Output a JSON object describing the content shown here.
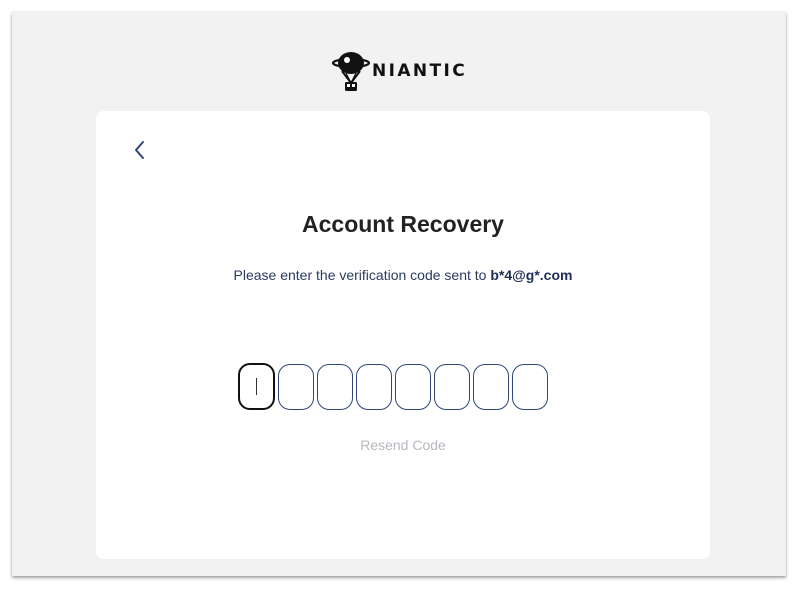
{
  "brand": {
    "name": "NIANTIC",
    "logo_icon": "niantic-balloon-logo"
  },
  "card": {
    "back_icon": "chevron-left-icon",
    "title": "Account Recovery",
    "subtitle_prefix": "Please enter the verification code sent to",
    "email": "b*4@g*.com",
    "code_length": 8,
    "resend_label": "Resend Code"
  },
  "colors": {
    "background": "#f2f2f2",
    "card": "#ffffff",
    "accent_navy": "#2f4778",
    "title": "#222222",
    "muted": "#b5b8be"
  }
}
